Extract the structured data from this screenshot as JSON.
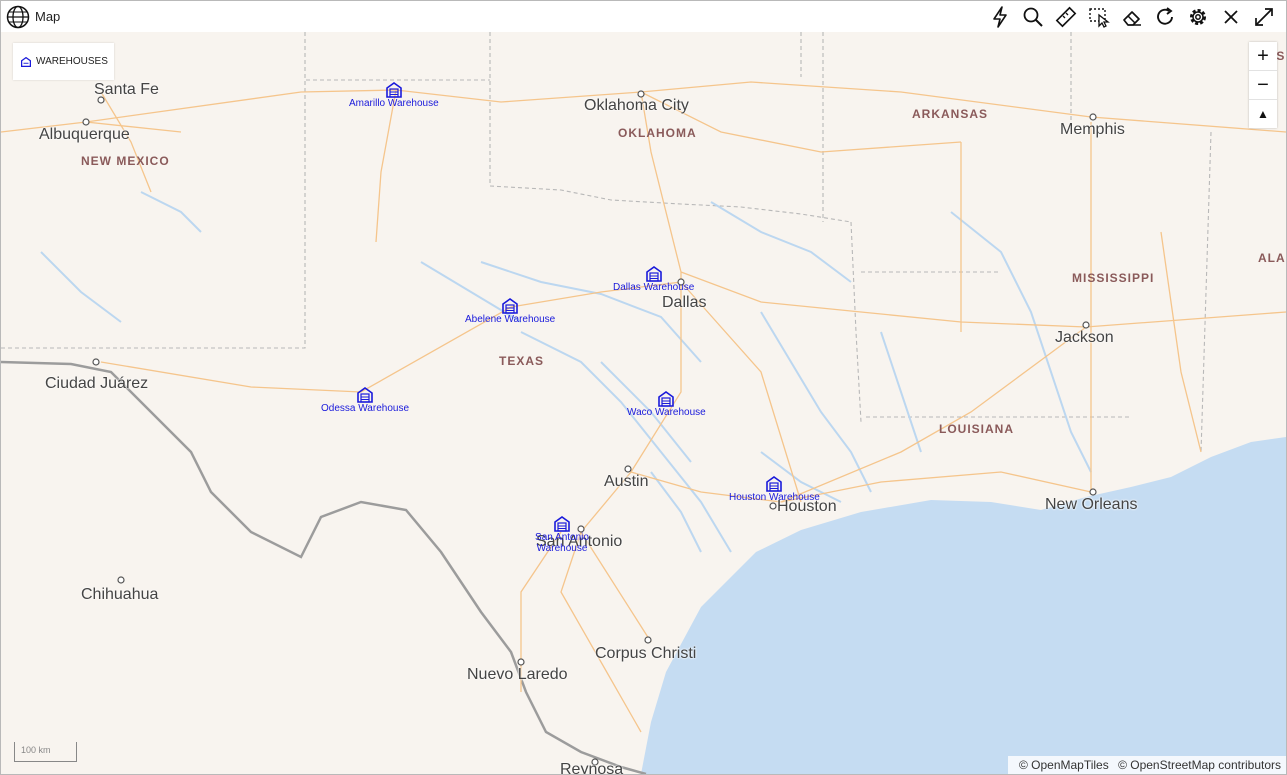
{
  "window": {
    "title": "Map"
  },
  "toolbar": {
    "tools": [
      "lightning-icon",
      "search-icon",
      "ruler-icon",
      "select-area-icon",
      "eraser-icon",
      "refresh-icon",
      "gear-icon",
      "close-icon",
      "expand-icon"
    ]
  },
  "layers": {
    "label": "WAREHOUSES"
  },
  "zoom": {
    "in": "+",
    "out": "−",
    "reset": "▲"
  },
  "scale": {
    "label": "100 km"
  },
  "attribution": {
    "a": "© OpenMapTiles",
    "b": "© OpenStreetMap contributors"
  },
  "cities": [
    "Santa Fe",
    "Albuquerque",
    "Oklahoma City",
    "Memphis",
    "Dallas",
    "Jackson",
    "Ciudad Juárez",
    "Austin",
    "Houston",
    "New Orleans",
    "San Antonio",
    "Chihuahua",
    "Corpus Christi",
    "Nuevo Laredo",
    "Reynosa"
  ],
  "states": [
    "NEW MEXICO",
    "OKLAHOMA",
    "ARKANSAS",
    "MISSISSIPPI",
    "TEXAS",
    "LOUISIANA",
    "ALA",
    "IS"
  ],
  "warehouses": [
    "Amarillo Warehouse",
    "Dallas Warehouse",
    "Abelene Warehouse",
    "Odessa Warehouse",
    "Waco Warehouse",
    "Houston Warehouse",
    "San Antonio Warehouse"
  ],
  "colors": {
    "land": "#f8f4ef",
    "water": "#c5dcf2",
    "road": "#f5c58c",
    "marker": "#1a1adb"
  }
}
